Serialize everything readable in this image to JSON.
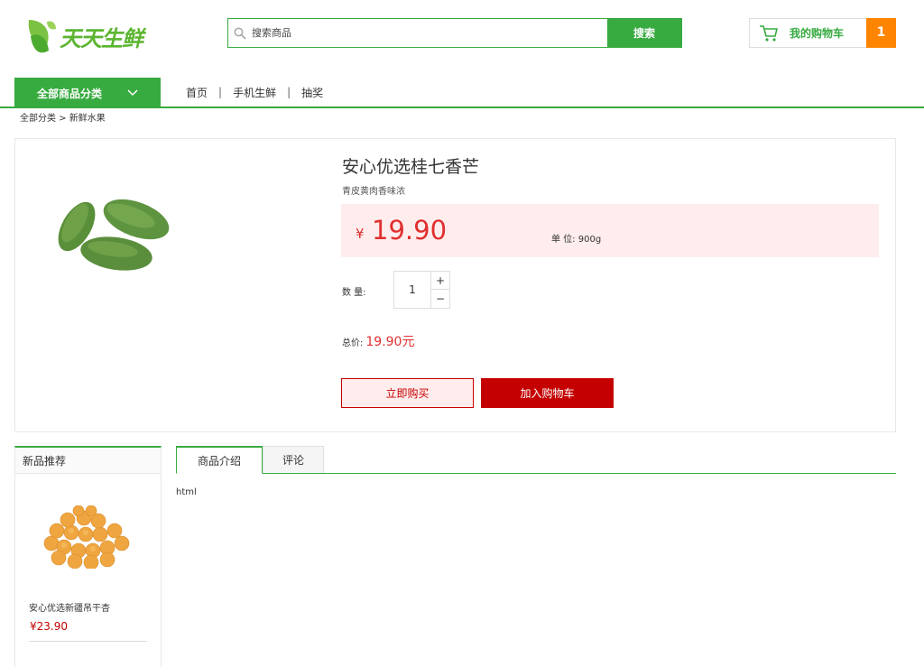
{
  "header": {
    "logo_text": "天天生鲜",
    "search": {
      "placeholder": "搜索商品",
      "button_label": "搜索"
    },
    "cart": {
      "label": "我的购物车",
      "count": "1"
    }
  },
  "nav": {
    "category_button": "全部商品分类",
    "links": [
      "首页",
      "手机生鲜",
      "抽奖"
    ],
    "separator": "|"
  },
  "breadcrumb": "全部分类 > 新鲜水果",
  "product": {
    "title": "安心优选桂七香芒",
    "subtitle": "青皮黄肉香味浓",
    "currency": "¥",
    "price": "19.90",
    "unit_label": "单 位: 900g",
    "quantity_label": "数 量:",
    "quantity_value": "1",
    "plus": "+",
    "minus": "−",
    "total_label": "总价:",
    "total_value": "19.90元",
    "buy_now": "立即购买",
    "add_to_cart": "加入购物车"
  },
  "recommend": {
    "title": "新品推荐",
    "item_name": "安心优选新疆吊干杏",
    "item_price": "¥23.90"
  },
  "tabs": {
    "items": [
      "商品介绍",
      "评论"
    ],
    "content": "html"
  },
  "colors": {
    "brand_green": "#37ab40",
    "price_red": "#e02f2f",
    "button_red": "#c40000",
    "cart_orange": "#ff8400"
  }
}
